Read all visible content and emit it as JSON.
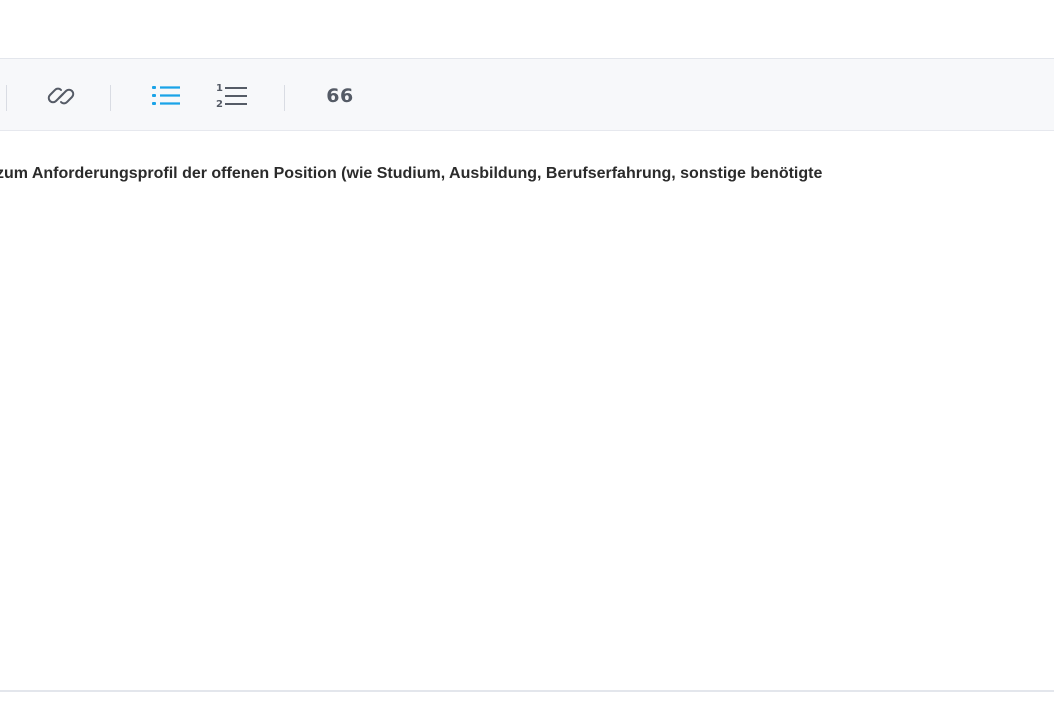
{
  "toolbar": {
    "tools": [
      {
        "icon": "link-icon",
        "active": false
      },
      {
        "icon": "bullet-list-icon",
        "active": true
      },
      {
        "icon": "numbered-list-icon",
        "active": false
      },
      {
        "icon": "blockquote-icon",
        "label": "66",
        "active": false
      }
    ],
    "numbered_list_digits": [
      "1",
      "2"
    ],
    "active_color": "#1aa3e8",
    "icon_color": "#555b66"
  },
  "editor": {
    "content": "zum Anforderungsprofil der offenen Position (wie Studium, Ausbildung, Berufserfahrung, sonstige benötigte"
  }
}
